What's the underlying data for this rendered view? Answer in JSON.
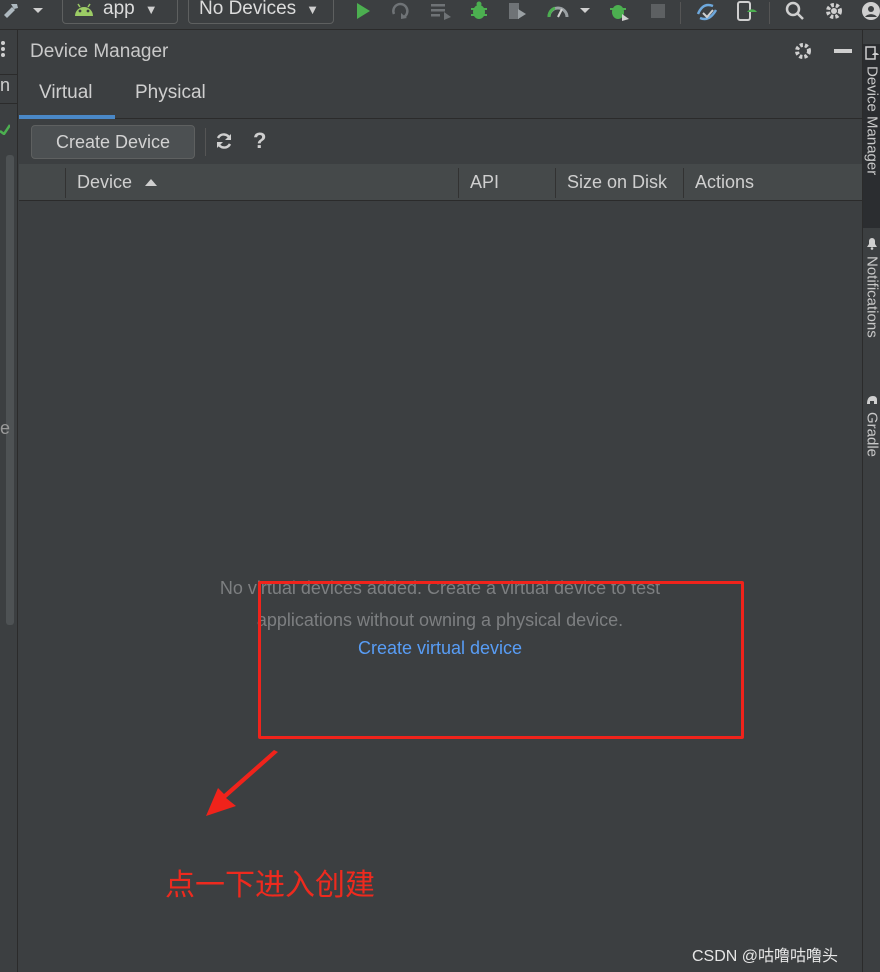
{
  "toolbar": {
    "module_combo": {
      "label": "app",
      "icon": "android-icon"
    },
    "device_combo": {
      "label": "No Devices"
    }
  },
  "left_gutter": {
    "fragment_top": "n",
    "fragment_mid": "e"
  },
  "right_sidebar": {
    "tabs": [
      {
        "label": "Device Manager",
        "icon": "device-manager-icon"
      },
      {
        "label": "Notifications",
        "icon": "bell-icon"
      },
      {
        "label": "Gradle",
        "icon": "gradle-icon"
      }
    ]
  },
  "panel": {
    "title": "Device Manager",
    "tabs": [
      {
        "label": "Virtual",
        "active": true
      },
      {
        "label": "Physical",
        "active": false
      }
    ],
    "create_button": "Create Device",
    "help_label": "?",
    "columns": [
      "Device",
      "API",
      "Size on Disk",
      "Actions"
    ],
    "empty_message_line1": "No virtual devices added. Create a virtual device to test",
    "empty_message_line2": "applications without owning a physical device.",
    "create_link": "Create virtual device"
  },
  "annotation": {
    "text": "点一下进入创建"
  },
  "watermark": "CSDN @咕噜咕噜头",
  "colors": {
    "background": "#3c3f41",
    "link": "#589df6",
    "run_green": "#4caf50",
    "annotation_red": "#f0231b",
    "tab_underline": "#4a88c7"
  }
}
